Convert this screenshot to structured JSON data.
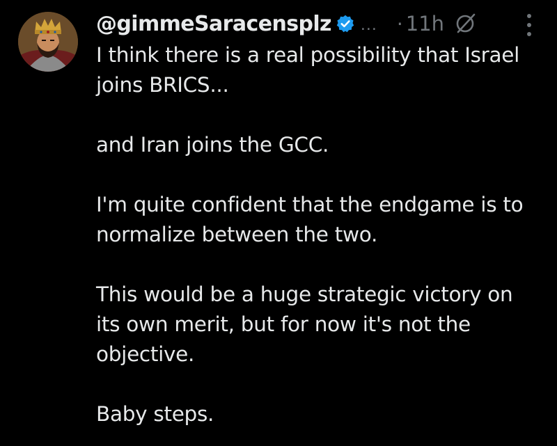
{
  "post": {
    "author": {
      "handle": "@gimmeSaracensplz",
      "verified": true,
      "avatar_icon": "crusader-king-portrait"
    },
    "header": {
      "truncation": "...",
      "separator": "·",
      "timestamp": "11h",
      "grok_icon": "grok-icon",
      "more_icon": "more-vertical-icon"
    },
    "body": {
      "paragraphs": [
        "I think there is a real possibility that Israel joins BRICS...",
        "and Iran joins the GCC.",
        "I'm quite confident that the endgame is to normalize between the two.",
        "This would be a huge strategic victory on its own merit, but for now it's not the objective.",
        "Baby steps."
      ]
    },
    "colors": {
      "background": "#000000",
      "text": "#e7e9ea",
      "muted": "#71767b",
      "verified_blue": "#1d9bf0"
    }
  }
}
